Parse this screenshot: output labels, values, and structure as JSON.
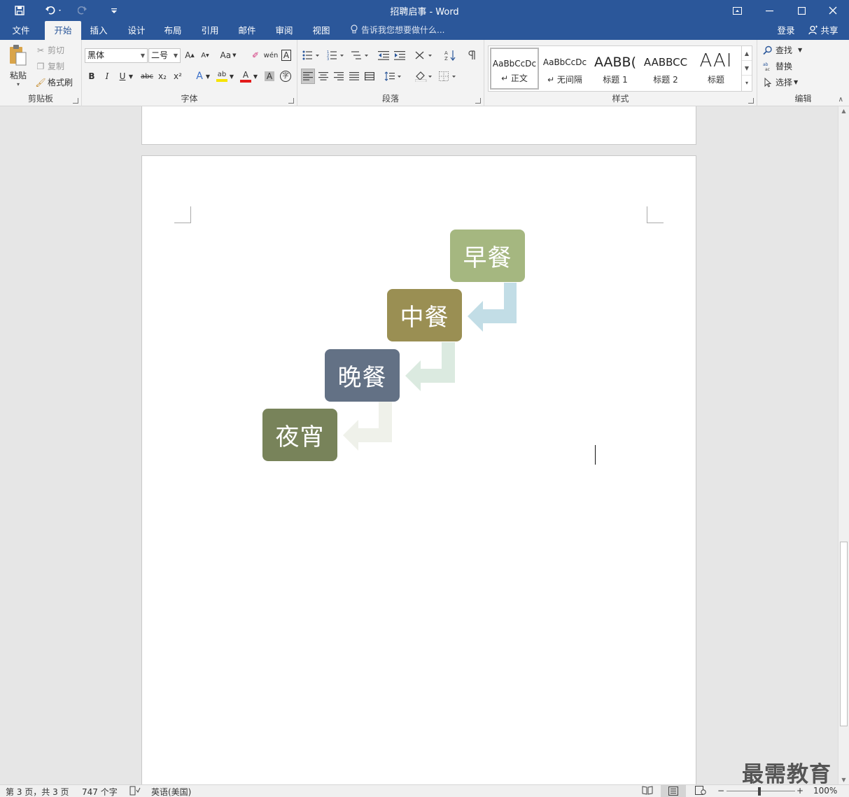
{
  "window": {
    "title": "招聘启事 - Word",
    "signin": "登录",
    "share": "共享"
  },
  "tabs": [
    {
      "label": "文件"
    },
    {
      "label": "开始",
      "active": true
    },
    {
      "label": "插入"
    },
    {
      "label": "设计"
    },
    {
      "label": "布局"
    },
    {
      "label": "引用"
    },
    {
      "label": "邮件"
    },
    {
      "label": "审阅"
    },
    {
      "label": "视图"
    }
  ],
  "tell_me": "告诉我您想要做什么...",
  "clipboard": {
    "paste": "粘贴",
    "cut": "剪切",
    "copy": "复制",
    "format_painter": "格式刷",
    "label": "剪贴板"
  },
  "font": {
    "family": "黑体",
    "size": "二号",
    "label": "字体",
    "case_label": "Aa",
    "bold": "B",
    "italic": "I",
    "underline": "U",
    "strike": "abc",
    "subscript": "x₂",
    "superscript": "x²",
    "phonetic": "wén",
    "char_border": "A",
    "grow": "A",
    "shrink": "A",
    "effects": "A",
    "highlight": "ab",
    "font_color": "A",
    "shading": "A",
    "enclose": "字"
  },
  "paragraph": {
    "label": "段落"
  },
  "styles": {
    "label": "样式",
    "items": [
      {
        "sample": "AaBbCcDc",
        "name": "↵ 正文"
      },
      {
        "sample": "AaBbCcDc",
        "name": "↵ 无间隔"
      },
      {
        "sample": "AABB(",
        "name": "标题 1"
      },
      {
        "sample": "AABBCC",
        "name": "标题 2"
      },
      {
        "sample": "AAI",
        "name": "标题"
      }
    ]
  },
  "editing": {
    "label": "编辑",
    "find": "查找",
    "replace": "替换",
    "select": "选择"
  },
  "diagram": {
    "items": [
      {
        "text": "早餐",
        "color": "#a5b780"
      },
      {
        "text": "中餐",
        "color": "#9a8f53"
      },
      {
        "text": "晚餐",
        "color": "#637185"
      },
      {
        "text": "夜宵",
        "color": "#78835a"
      }
    ],
    "arrow_colors": [
      "#c2dde6",
      "#dbeae0",
      "#eff1ea"
    ]
  },
  "status": {
    "page": "第 3 页，共 3 页",
    "words": "747 个字",
    "language": "英语(美国)",
    "zoom": "100%"
  },
  "watermark": "最需教育"
}
